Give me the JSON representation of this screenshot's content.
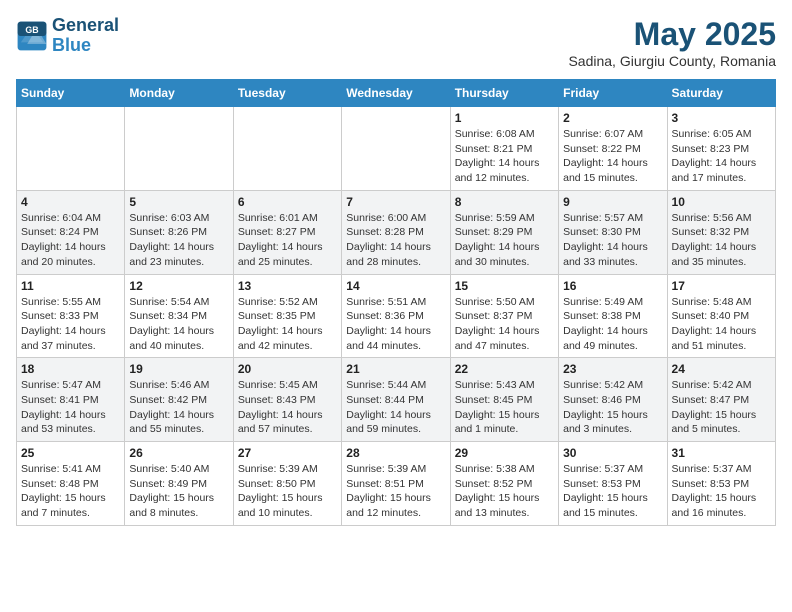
{
  "logo": {
    "line1": "General",
    "line2": "Blue"
  },
  "title": "May 2025",
  "subtitle": "Sadina, Giurgiu County, Romania",
  "days_of_week": [
    "Sunday",
    "Monday",
    "Tuesday",
    "Wednesday",
    "Thursday",
    "Friday",
    "Saturday"
  ],
  "weeks": [
    [
      {
        "day": "",
        "info": ""
      },
      {
        "day": "",
        "info": ""
      },
      {
        "day": "",
        "info": ""
      },
      {
        "day": "",
        "info": ""
      },
      {
        "day": "1",
        "info": "Sunrise: 6:08 AM\nSunset: 8:21 PM\nDaylight: 14 hours\nand 12 minutes."
      },
      {
        "day": "2",
        "info": "Sunrise: 6:07 AM\nSunset: 8:22 PM\nDaylight: 14 hours\nand 15 minutes."
      },
      {
        "day": "3",
        "info": "Sunrise: 6:05 AM\nSunset: 8:23 PM\nDaylight: 14 hours\nand 17 minutes."
      }
    ],
    [
      {
        "day": "4",
        "info": "Sunrise: 6:04 AM\nSunset: 8:24 PM\nDaylight: 14 hours\nand 20 minutes."
      },
      {
        "day": "5",
        "info": "Sunrise: 6:03 AM\nSunset: 8:26 PM\nDaylight: 14 hours\nand 23 minutes."
      },
      {
        "day": "6",
        "info": "Sunrise: 6:01 AM\nSunset: 8:27 PM\nDaylight: 14 hours\nand 25 minutes."
      },
      {
        "day": "7",
        "info": "Sunrise: 6:00 AM\nSunset: 8:28 PM\nDaylight: 14 hours\nand 28 minutes."
      },
      {
        "day": "8",
        "info": "Sunrise: 5:59 AM\nSunset: 8:29 PM\nDaylight: 14 hours\nand 30 minutes."
      },
      {
        "day": "9",
        "info": "Sunrise: 5:57 AM\nSunset: 8:30 PM\nDaylight: 14 hours\nand 33 minutes."
      },
      {
        "day": "10",
        "info": "Sunrise: 5:56 AM\nSunset: 8:32 PM\nDaylight: 14 hours\nand 35 minutes."
      }
    ],
    [
      {
        "day": "11",
        "info": "Sunrise: 5:55 AM\nSunset: 8:33 PM\nDaylight: 14 hours\nand 37 minutes."
      },
      {
        "day": "12",
        "info": "Sunrise: 5:54 AM\nSunset: 8:34 PM\nDaylight: 14 hours\nand 40 minutes."
      },
      {
        "day": "13",
        "info": "Sunrise: 5:52 AM\nSunset: 8:35 PM\nDaylight: 14 hours\nand 42 minutes."
      },
      {
        "day": "14",
        "info": "Sunrise: 5:51 AM\nSunset: 8:36 PM\nDaylight: 14 hours\nand 44 minutes."
      },
      {
        "day": "15",
        "info": "Sunrise: 5:50 AM\nSunset: 8:37 PM\nDaylight: 14 hours\nand 47 minutes."
      },
      {
        "day": "16",
        "info": "Sunrise: 5:49 AM\nSunset: 8:38 PM\nDaylight: 14 hours\nand 49 minutes."
      },
      {
        "day": "17",
        "info": "Sunrise: 5:48 AM\nSunset: 8:40 PM\nDaylight: 14 hours\nand 51 minutes."
      }
    ],
    [
      {
        "day": "18",
        "info": "Sunrise: 5:47 AM\nSunset: 8:41 PM\nDaylight: 14 hours\nand 53 minutes."
      },
      {
        "day": "19",
        "info": "Sunrise: 5:46 AM\nSunset: 8:42 PM\nDaylight: 14 hours\nand 55 minutes."
      },
      {
        "day": "20",
        "info": "Sunrise: 5:45 AM\nSunset: 8:43 PM\nDaylight: 14 hours\nand 57 minutes."
      },
      {
        "day": "21",
        "info": "Sunrise: 5:44 AM\nSunset: 8:44 PM\nDaylight: 14 hours\nand 59 minutes."
      },
      {
        "day": "22",
        "info": "Sunrise: 5:43 AM\nSunset: 8:45 PM\nDaylight: 15 hours\nand 1 minute."
      },
      {
        "day": "23",
        "info": "Sunrise: 5:42 AM\nSunset: 8:46 PM\nDaylight: 15 hours\nand 3 minutes."
      },
      {
        "day": "24",
        "info": "Sunrise: 5:42 AM\nSunset: 8:47 PM\nDaylight: 15 hours\nand 5 minutes."
      }
    ],
    [
      {
        "day": "25",
        "info": "Sunrise: 5:41 AM\nSunset: 8:48 PM\nDaylight: 15 hours\nand 7 minutes."
      },
      {
        "day": "26",
        "info": "Sunrise: 5:40 AM\nSunset: 8:49 PM\nDaylight: 15 hours\nand 8 minutes."
      },
      {
        "day": "27",
        "info": "Sunrise: 5:39 AM\nSunset: 8:50 PM\nDaylight: 15 hours\nand 10 minutes."
      },
      {
        "day": "28",
        "info": "Sunrise: 5:39 AM\nSunset: 8:51 PM\nDaylight: 15 hours\nand 12 minutes."
      },
      {
        "day": "29",
        "info": "Sunrise: 5:38 AM\nSunset: 8:52 PM\nDaylight: 15 hours\nand 13 minutes."
      },
      {
        "day": "30",
        "info": "Sunrise: 5:37 AM\nSunset: 8:53 PM\nDaylight: 15 hours\nand 15 minutes."
      },
      {
        "day": "31",
        "info": "Sunrise: 5:37 AM\nSunset: 8:53 PM\nDaylight: 15 hours\nand 16 minutes."
      }
    ]
  ]
}
